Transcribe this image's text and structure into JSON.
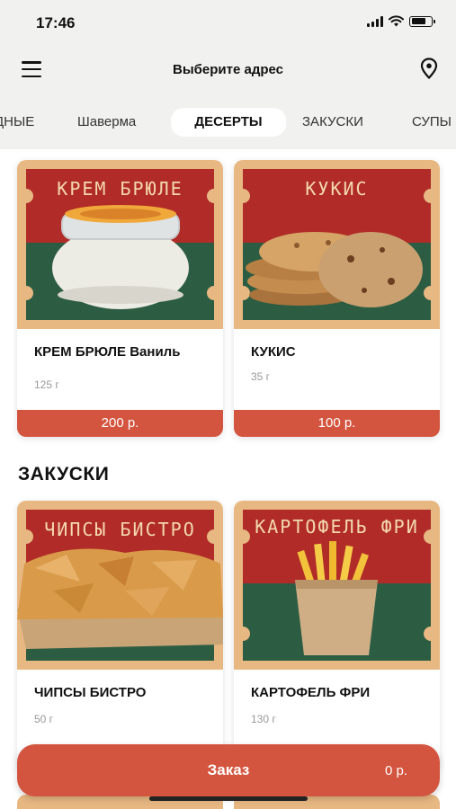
{
  "status_bar": {
    "time": "17:46",
    "battery_level": 0.75
  },
  "header": {
    "address_title": "Выберите адрес"
  },
  "categories": [
    {
      "label": "ДНЫЕ"
    },
    {
      "label": "Шаверма"
    },
    {
      "label": "ДЕСЕРТЫ",
      "active": true
    },
    {
      "label": "ЗАКУСКИ"
    },
    {
      "label": "СУПЫ"
    }
  ],
  "desserts": [
    {
      "poster": "КРЕМ БРЮЛЕ",
      "name": "КРЕМ БРЮЛЕ Ваниль",
      "weight": "125 г",
      "price": "200 р."
    },
    {
      "poster": "КУКИС",
      "name": "КУКИС",
      "weight": "35 г",
      "price": "100 р."
    }
  ],
  "snacks_section": {
    "title": "ЗАКУСКИ"
  },
  "snacks": [
    {
      "poster": "ЧИПСЫ БИСТРО",
      "name": "ЧИПСЫ БИСТРО",
      "weight": "50 г"
    },
    {
      "poster": "КАРТОФЕЛЬ ФРИ",
      "name": "КАРТОФЕЛЬ ФРИ",
      "weight": "130 г"
    }
  ],
  "order": {
    "label": "Заказ",
    "sum": "0 р."
  },
  "colors": {
    "accent": "#d4553f",
    "poster_red": "#b12b28",
    "poster_green": "#2c5d42",
    "poster_frame": "#e8b883"
  }
}
